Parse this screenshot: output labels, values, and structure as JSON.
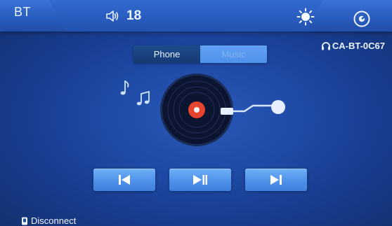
{
  "header": {
    "mode_label": "BT",
    "volume_value": "18",
    "icons": {
      "volume": "speaker-icon",
      "brightness": "sun-icon",
      "settings": "settings-icon"
    }
  },
  "device": {
    "id_label": "CA-BT-0C67",
    "icon": "headphones-icon"
  },
  "tabs": [
    {
      "label": "Phone",
      "active": false
    },
    {
      "label": "Music",
      "active": true
    }
  ],
  "player": {
    "icons": {
      "notes": "music-notes-icon",
      "record": "vinyl-record-icon",
      "tonearm": "tonearm-icon"
    }
  },
  "controls": {
    "previous": "skip-previous-icon",
    "play_pause": "play-pause-icon",
    "next": "skip-next-icon"
  },
  "footer": {
    "disconnect_label": "Disconnect",
    "disconnect_icon": "bluetooth-device-icon"
  },
  "colors": {
    "background": "#1f4aa6",
    "topbar": "#2a5dc0",
    "button": "#4f92ea",
    "record_label": "#e5442f"
  }
}
